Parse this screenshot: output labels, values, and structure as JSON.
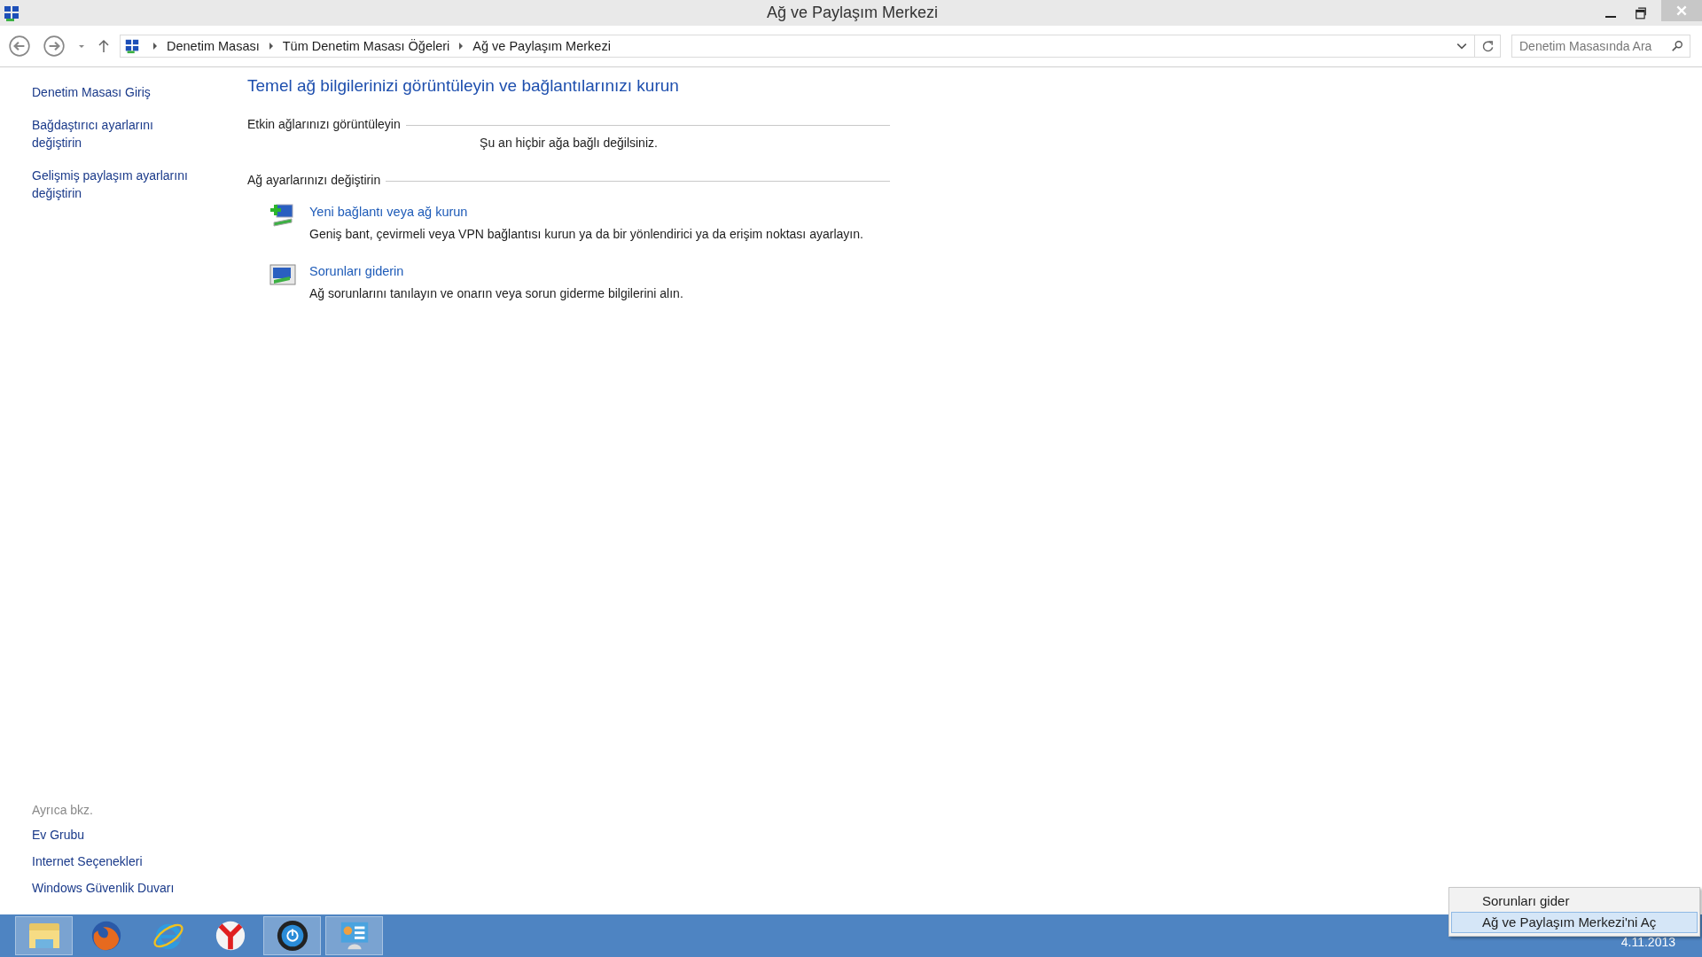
{
  "window": {
    "title": "Ağ ve Paylaşım Merkezi"
  },
  "breadcrumb": [
    "Denetim Masası",
    "Tüm Denetim Masası Öğeleri",
    "Ağ ve Paylaşım Merkezi"
  ],
  "search": {
    "placeholder": "Denetim Masasında Ara"
  },
  "sidebar": {
    "items": [
      "Denetim Masası Giriş",
      "Bağdaştırıcı ayarlarını değiştirin",
      "Gelişmiş paylaşım ayarlarını değiştirin"
    ],
    "see_also": {
      "title": "Ayrıca bkz.",
      "items": [
        "Ev Grubu",
        "Internet Seçenekleri",
        "Windows Güvenlik Duvarı"
      ]
    }
  },
  "heading": "Temel ağ bilgilerinizi görüntüleyin ve bağlantılarınızı kurun",
  "active_networks": {
    "title": "Etkin ağlarınızı görüntüleyin",
    "message": "Şu an hiçbir ağa bağlı değilsiniz."
  },
  "settings": {
    "title": "Ağ ayarlarınızı değiştirin",
    "tasks": [
      {
        "kind": "new",
        "link": "Yeni bağlantı veya ağ kurun",
        "description": "Geniş bant, çevirmeli veya VPN bağlantısı kurun ya da bir yönlendirici ya da erişim noktası ayarlayın."
      },
      {
        "kind": "troubleshoot",
        "link": "Sorunları giderin",
        "description": "Ağ sorunlarını tanılayın ve onarın veya sorun giderme bilgilerini alın."
      }
    ]
  },
  "taskbar": {
    "apps": [
      {
        "kind": "folder",
        "active": true
      },
      {
        "kind": "firefox",
        "active": false
      },
      {
        "kind": "ie",
        "active": false
      },
      {
        "kind": "yandex",
        "active": false
      },
      {
        "kind": "power",
        "active": true
      },
      {
        "kind": "panel",
        "active": true
      }
    ],
    "clock": "4.11.2013"
  },
  "context_menu": {
    "items": [
      {
        "label": "Sorunları gider",
        "selected": false
      },
      {
        "label": "Ağ ve Paylaşım Merkezi'ni Aç",
        "selected": true
      }
    ]
  }
}
